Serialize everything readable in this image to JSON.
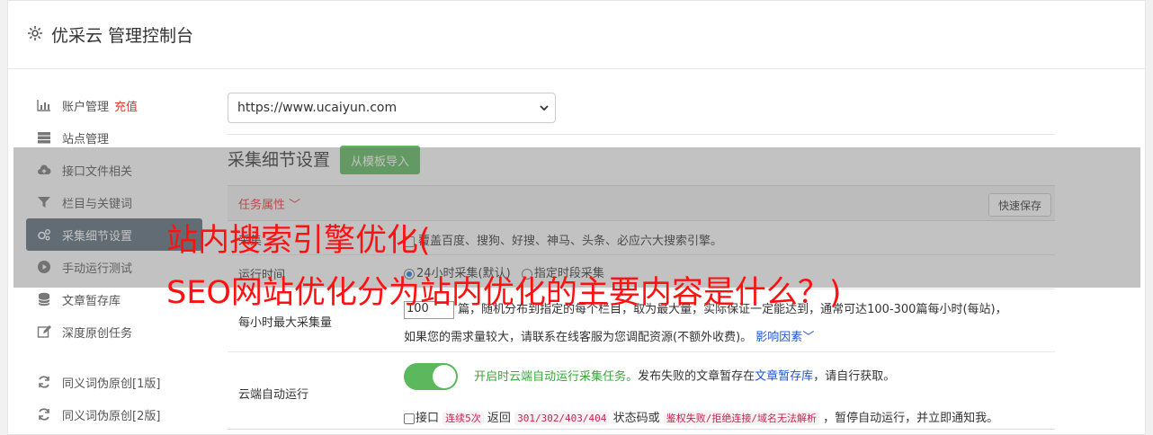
{
  "header": {
    "title": "优采云 管理控制台",
    "icon": "gear-icon"
  },
  "sidebar": {
    "items": [
      {
        "label": "账户管理",
        "extra": "充值",
        "icon": "bar-chart-icon"
      },
      {
        "label": "站点管理",
        "icon": "server-icon"
      },
      {
        "label": "接口文件相关",
        "icon": "cloud-upload-icon"
      },
      {
        "label": "栏目与关键词",
        "icon": "filter-icon"
      },
      {
        "label": "采集细节设置",
        "icon": "cogs-icon",
        "active": true
      },
      {
        "label": "手动运行测试",
        "icon": "play-circle-icon"
      },
      {
        "label": "文章暂存库",
        "icon": "database-icon"
      },
      {
        "label": "深度原创任务",
        "icon": "edit-icon"
      },
      {
        "label": "同义词伪原创[1版]",
        "icon": "refresh-icon"
      },
      {
        "label": "同义词伪原创[2版]",
        "icon": "refresh-icon"
      }
    ]
  },
  "main": {
    "site_select": "https://www.ucaiyun.com",
    "section_title": "采集细节设置",
    "import_button": "从模板导入",
    "task_attr": "任务属性",
    "quick_save": "快速保存",
    "row1": {
      "label": "采集",
      "text": "覆盖百度、搜狗、好搜、神马、头条、必应六大搜索引擎。"
    },
    "row2": {
      "label": "运行时间",
      "opt1": "24小时采集(默认)",
      "opt2": "指定时段采集"
    },
    "row3": {
      "label": "每小时最大采集量",
      "value": "100",
      "line1": "篇，随机分布到指定的每个栏目，取为最大量，实际保证一定能达到，通常可达100-300篇每小时(每站)，",
      "line2": "如果您的需求量较大，请联系在线客服为您调配资源(不额外收费)。",
      "link": "影响因素"
    },
    "row4": {
      "label": "云端自动运行",
      "toggle_on": true,
      "green_text": "开启时云端自动运行采集任务。",
      "text_a": "发布失败的文章暂存在",
      "link": "文章暂存库",
      "text_b": "，请自行获取。",
      "line2_a": "接口",
      "code1": "连续5次",
      "line2_b": "返回",
      "code2": "301/302/403/404",
      "line2_c": "状态码或",
      "code3": "鉴权失败/拒绝连接/域名无法解析",
      "line2_d": "，暂停自动运行，并立即通知我。"
    }
  },
  "overlay": {
    "line1": "站内搜索引擎优化(",
    "line2": "SEO网站优化分为站内优化的主要内容是什么？)"
  },
  "colors": {
    "active_nav": "#5b6b7b",
    "accent_red": "#e33333",
    "green": "#5cb85c",
    "link": "#2255cc"
  }
}
